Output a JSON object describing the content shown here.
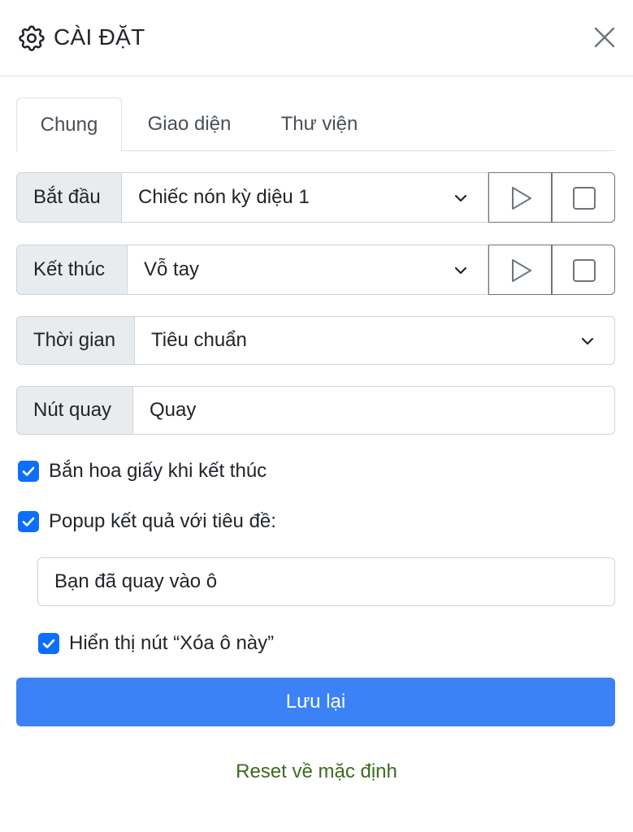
{
  "header": {
    "title": "CÀI ĐẶT",
    "icon": "gear-icon",
    "close_icon": "close-icon"
  },
  "tabs": [
    {
      "label": "Chung",
      "active": true
    },
    {
      "label": "Giao diện",
      "active": false
    },
    {
      "label": "Thư viện",
      "active": false
    }
  ],
  "start": {
    "label": "Bắt đầu",
    "value": "Chiếc nón kỳ diệu 1"
  },
  "end": {
    "label": "Kết thúc",
    "value": "Vỗ tay"
  },
  "duration": {
    "label": "Thời gian",
    "value": "Tiêu chuẩn"
  },
  "spin_button": {
    "label": "Nút quay",
    "value": "Quay"
  },
  "options": {
    "confetti": {
      "label": "Bắn hoa giấy khi kết thúc",
      "checked": true
    },
    "popup": {
      "label": "Popup kết quả với tiêu đề:",
      "checked": true
    },
    "popup_title_value": "Bạn đã quay vào ô",
    "show_remove": {
      "label": "Hiển thị nút “Xóa ô này”",
      "checked": true
    }
  },
  "actions": {
    "save_label": "Lưu lại",
    "reset_label": "Reset về mặc định"
  },
  "colors": {
    "primary": "#3b82f6",
    "checkbox": "#0d6efd",
    "reset_link": "#3d6b1f"
  }
}
